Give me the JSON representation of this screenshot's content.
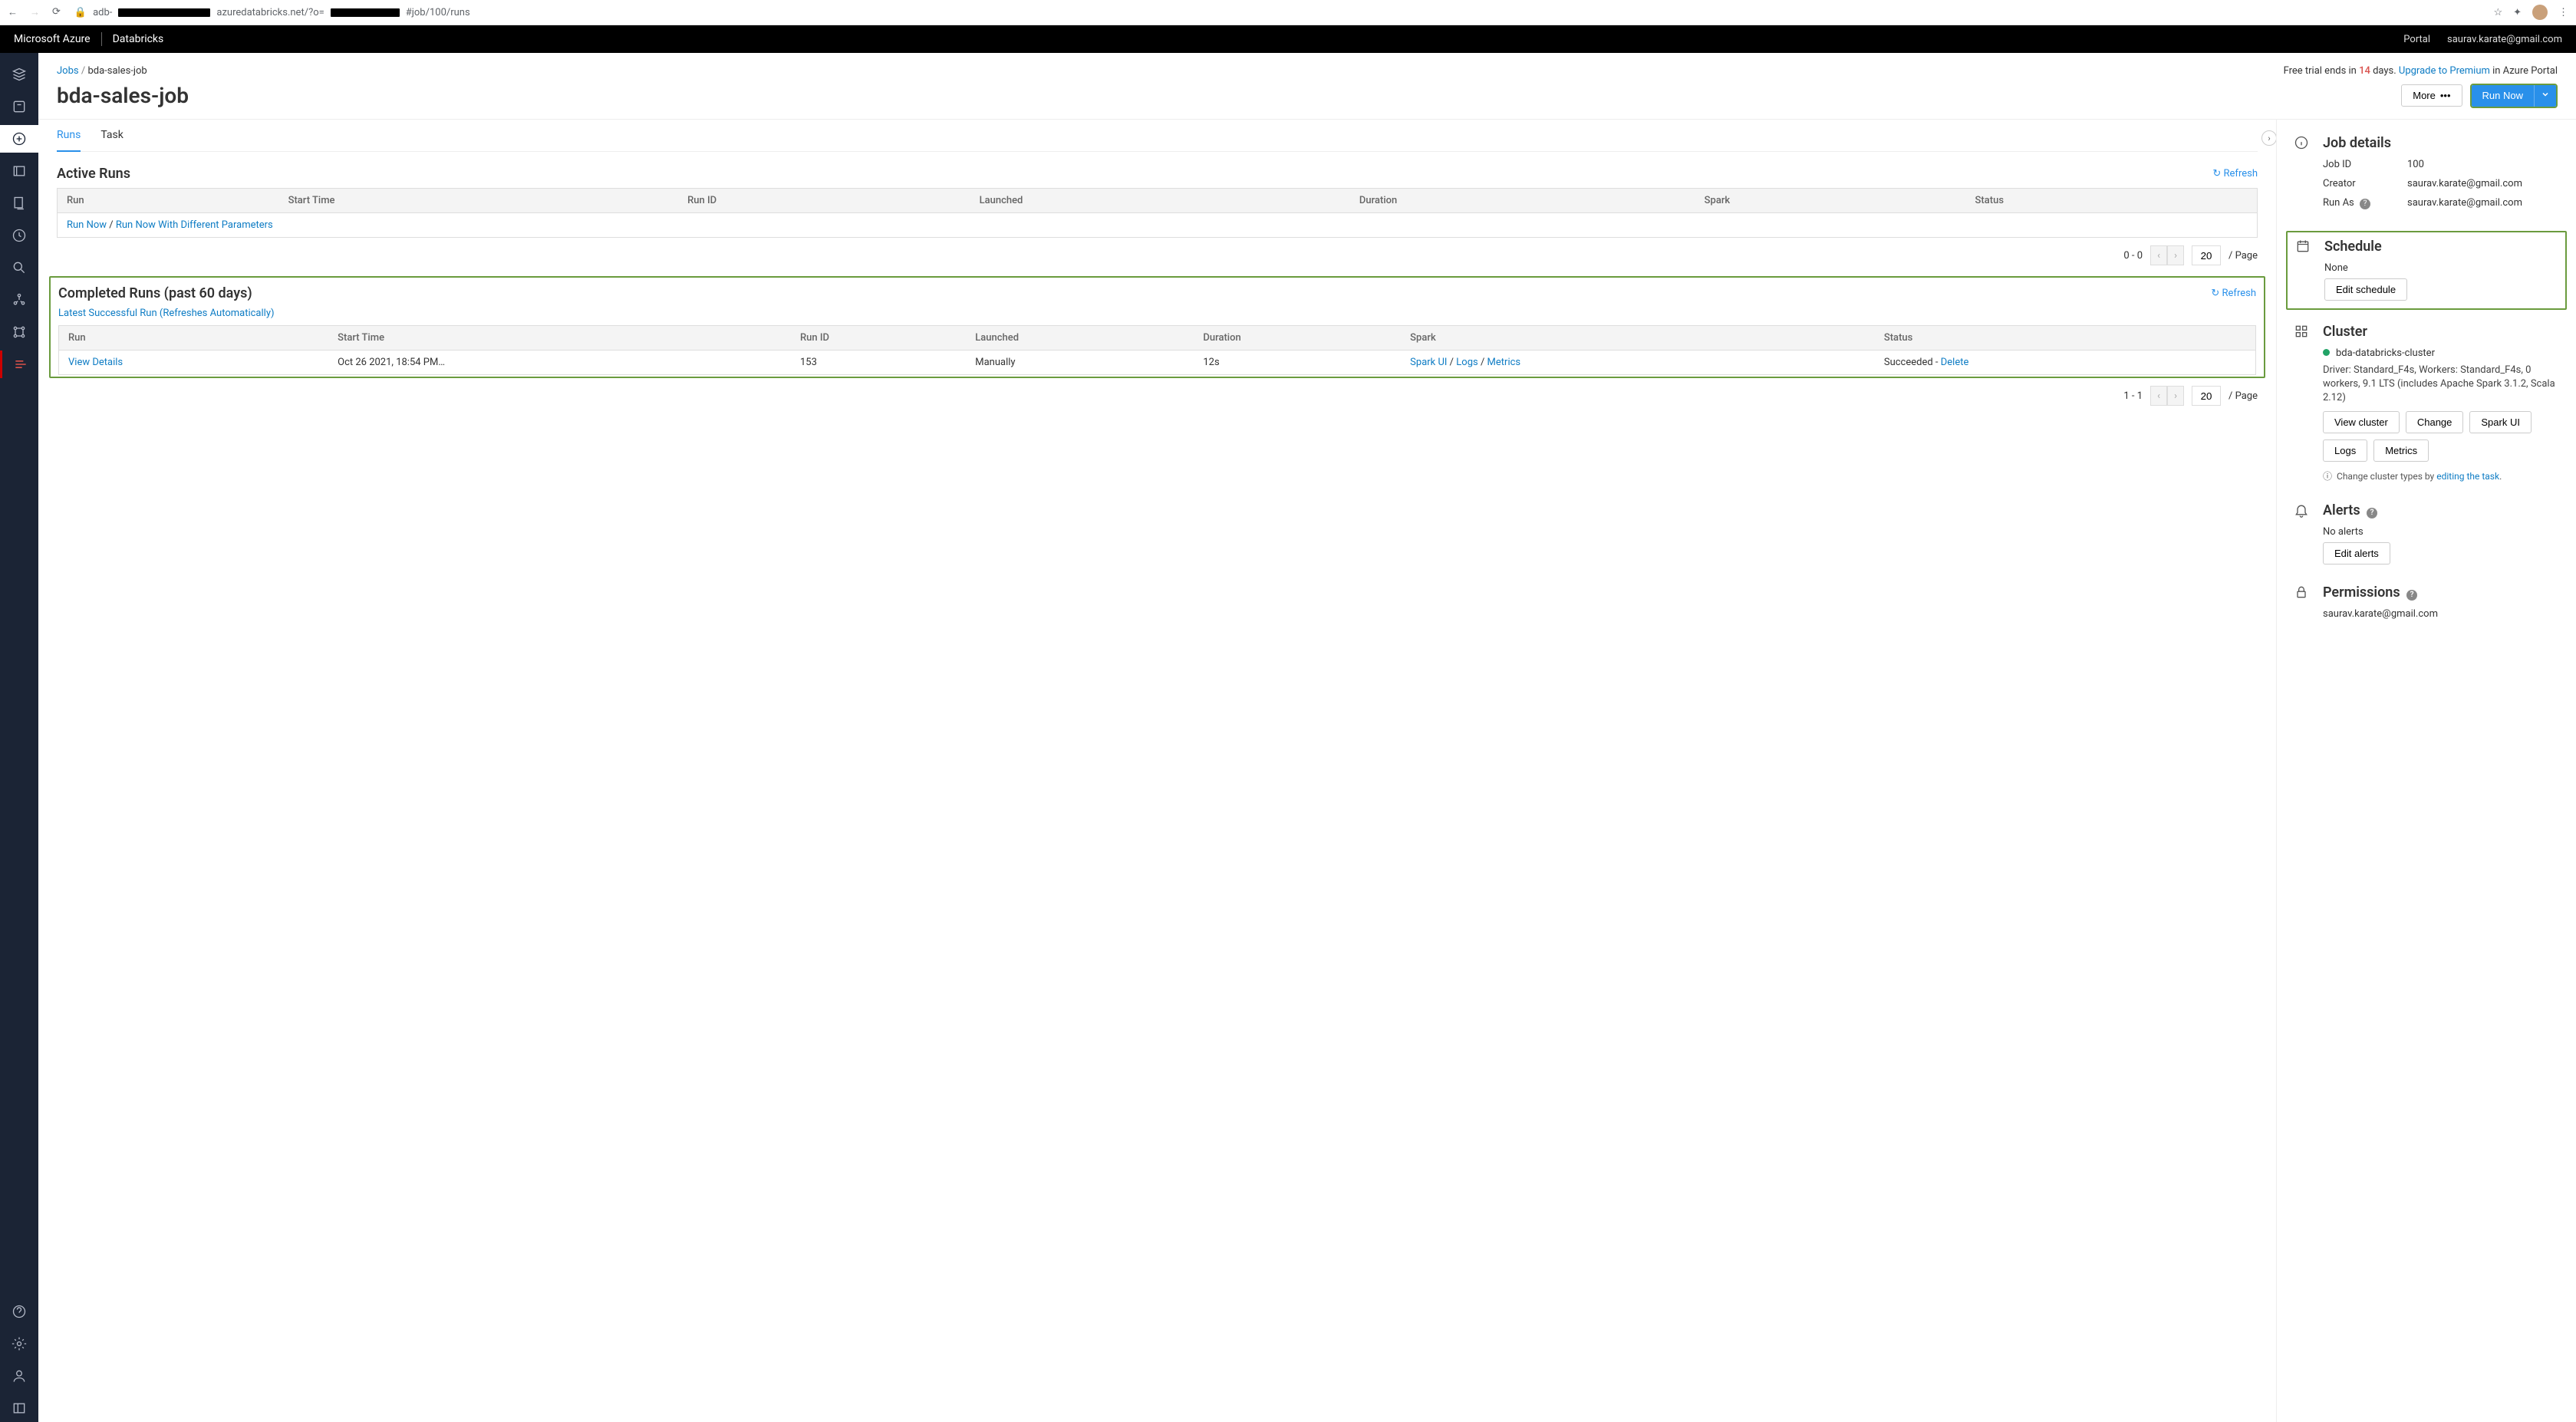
{
  "browser": {
    "url_pre": "adb-",
    "url_mid": "azuredatabricks.net/?o=",
    "url_post": "#job/100/runs"
  },
  "topbar": {
    "brand1": "Microsoft Azure",
    "brand2": "Databricks",
    "portal": "Portal",
    "email": "saurav.karate@gmail.com"
  },
  "bc": {
    "jobs": "Jobs",
    "sep": " / ",
    "name": "bda-sales-job"
  },
  "trial": {
    "pre": "Free trial ends in ",
    "days": "14",
    "post": " days. ",
    "upgrade": "Upgrade to Premium",
    "suffix": " in Azure Portal"
  },
  "title": "bda-sales-job",
  "buttons": {
    "more": "More",
    "run_now": "Run Now"
  },
  "tabs": [
    "Runs",
    "Task"
  ],
  "refresh": "Refresh",
  "active_runs": {
    "heading": "Active Runs",
    "cols": [
      "Run",
      "Start Time",
      "Run ID",
      "Launched",
      "Duration",
      "Spark",
      "Status"
    ],
    "run_now": "Run Now",
    "sep": " / ",
    "run_params": "Run Now With Different Parameters",
    "pager_range": "0 - 0",
    "page_size": "20",
    "per_page": "/ Page"
  },
  "completed_runs": {
    "heading": "Completed Runs (past 60 days)",
    "latest": "Latest Successful Run (Refreshes Automatically)",
    "cols": [
      "Run",
      "Start Time",
      "Run ID",
      "Launched",
      "Duration",
      "Spark",
      "Status"
    ],
    "row": {
      "view": "View Details",
      "start": "Oct 26 2021, 18:54 PM…",
      "run_id": "153",
      "launched": "Manually",
      "duration": "12s",
      "spark_ui": "Spark UI",
      "logs": "Logs",
      "metrics": "Metrics",
      "status_pre": "Succeeded - ",
      "delete": "Delete"
    },
    "pager_range": "1 - 1",
    "page_size": "20",
    "per_page": "/ Page"
  },
  "details": {
    "heading": "Job details",
    "job_id_k": "Job ID",
    "job_id_v": "100",
    "creator_k": "Creator",
    "creator_v": "saurav.karate@gmail.com",
    "runas_k": "Run As",
    "runas_v": "saurav.karate@gmail.com"
  },
  "schedule": {
    "heading": "Schedule",
    "none": "None",
    "edit": "Edit schedule"
  },
  "cluster": {
    "heading": "Cluster",
    "name": "bda-databricks-cluster",
    "desc": "Driver: Standard_F4s, Workers: Standard_F4s, 0 workers, 9.1 LTS (includes Apache Spark 3.1.2, Scala 2.12)",
    "btns": [
      "View cluster",
      "Change",
      "Spark UI",
      "Logs",
      "Metrics"
    ],
    "change_pre": "Change cluster types by ",
    "change_link": "editing the task",
    "change_post": "."
  },
  "alerts": {
    "heading": "Alerts",
    "none": "No alerts",
    "edit": "Edit alerts"
  },
  "permissions": {
    "heading": "Permissions",
    "user": "saurav.karate@gmail.com"
  }
}
